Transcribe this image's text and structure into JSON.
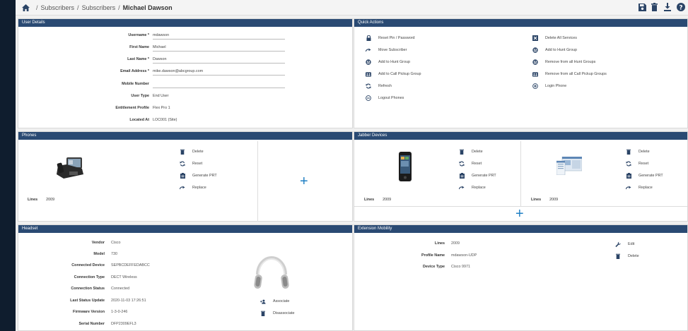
{
  "breadcrumb": {
    "items": [
      "Subscribers",
      "Subscribers"
    ],
    "current": "Michael Dawson"
  },
  "header_actions": [
    "save-icon",
    "delete-icon",
    "download-icon",
    "help-icon"
  ],
  "user_details": {
    "title": "User Details",
    "fields": [
      {
        "label": "Username *",
        "value": "mdawson"
      },
      {
        "label": "First Name",
        "value": "Michael"
      },
      {
        "label": "Last Name *",
        "value": "Dawson"
      },
      {
        "label": "Email Address *",
        "value": "mike.dawson@abcgroup.com"
      },
      {
        "label": "Mobile Number",
        "value": ""
      },
      {
        "label": "User Type",
        "value": "End User"
      },
      {
        "label": "Entitlement Profile",
        "value": "Flex Pro 1"
      },
      {
        "label": "Located At",
        "value": "LOC001 (Site)"
      }
    ]
  },
  "quick_actions": {
    "title": "Quick Actions",
    "left": [
      {
        "label": "Reset Pin / Password",
        "icon": "lock-icon"
      },
      {
        "label": "Move Subscriber",
        "icon": "move-arrow-icon"
      },
      {
        "label": "Add to Hunt Group",
        "icon": "hunt-group-icon"
      },
      {
        "label": "Add to Call Pickup Group",
        "icon": "pickup-group-icon"
      },
      {
        "label": "Refresh",
        "icon": "refresh-icon"
      },
      {
        "label": "Logout Phones",
        "icon": "logout-icon"
      }
    ],
    "right": [
      {
        "label": "Delete All Services",
        "icon": "delete-services-icon"
      },
      {
        "label": "Add to Hunt Group",
        "icon": "hunt-group-icon"
      },
      {
        "label": "Remove from all Hunt Groups",
        "icon": "hunt-group-icon"
      },
      {
        "label": "Remove from all Call Pickup Groups",
        "icon": "pickup-group-icon"
      },
      {
        "label": "Login Phone",
        "icon": "login-icon"
      }
    ]
  },
  "phones": {
    "title": "Phones",
    "actions": [
      "Delete",
      "Reset",
      "Generate PRT",
      "Replace"
    ],
    "lines_label": "Lines",
    "lines_value": "2009",
    "add": "+"
  },
  "jabber": {
    "title": "Jabber Devices",
    "devices": [
      {
        "actions": [
          "Delete",
          "Reset",
          "Generate PRT",
          "Replace"
        ],
        "lines_label": "Lines",
        "lines_value": "2009"
      },
      {
        "actions": [
          "Delete",
          "Reset",
          "Generate PRT",
          "Replace"
        ],
        "lines_label": "Lines",
        "lines_value": "2009"
      }
    ],
    "add": "+"
  },
  "headset": {
    "title": "Headset",
    "fields": [
      {
        "label": "Vendor",
        "value": "Cisco"
      },
      {
        "label": "Model",
        "value": "730"
      },
      {
        "label": "Connected Device",
        "value": "SEPBCDEFFEDABCC"
      },
      {
        "label": "Connection Type",
        "value": "DECT Wireless"
      },
      {
        "label": "Connection Status",
        "value": "Connected"
      },
      {
        "label": "Last Status Update",
        "value": "2020-11-03 17:26:51"
      },
      {
        "label": "Firmware Version",
        "value": "1-3-0-246"
      },
      {
        "label": "Serial Number",
        "value": "DFP2309EFL3"
      }
    ],
    "actions": [
      "Associate",
      "Disassociate"
    ]
  },
  "extension_mobility": {
    "title": "Extension Mobility",
    "fields": [
      {
        "label": "Lines",
        "value": "2009"
      },
      {
        "label": "Profile Name",
        "value": "mdawson-UDP"
      },
      {
        "label": "Device Type",
        "value": "Cisco 9971"
      }
    ],
    "actions": [
      "Edit",
      "Delete"
    ]
  }
}
